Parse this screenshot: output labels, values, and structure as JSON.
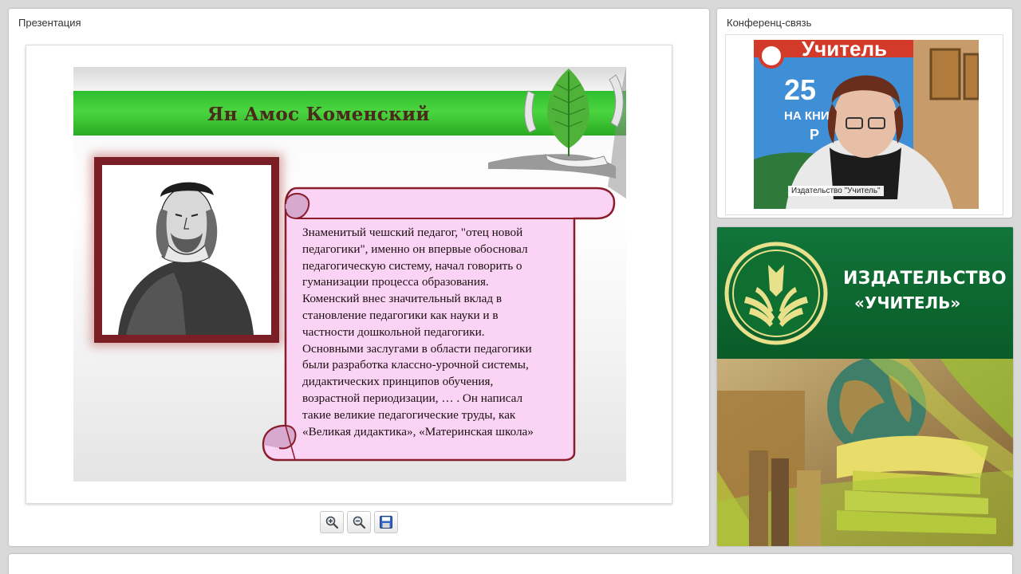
{
  "presentation": {
    "panel_title": "Презентация",
    "slide": {
      "title": "Ян Амос Коменский",
      "text_lines": [
        "Знаменитый чешский педагог, \"отец новой",
        "педагогики\", именно он впервые обосновал",
        "педагогическую систему, начал говорить о",
        "гуманизации процесса образования.",
        "Коменский внес значительный вклад в",
        "становление педагогики как науки и в",
        "частности дошкольной педагогики.",
        "Основными заслугами в области педагогики",
        "были разработка классно-урочной системы,",
        "дидактических принципов обучения,",
        "возрастной периодизации, … . Он написал",
        "такие великие педагогические труды, как",
        "«Великая дидактика», «Материнская школа»"
      ]
    },
    "toolbar": {
      "zoom_in_icon": "zoom-in-icon",
      "zoom_out_icon": "zoom-out-icon",
      "save_icon": "floppy-disk-icon"
    }
  },
  "conference": {
    "panel_title": "Конференц-связь",
    "video_caption": "Издательство \"Учитель\"",
    "poster": {
      "word": "Учитель",
      "number": "25",
      "line1": "НА КНИЖНОМ",
      "letter": "Р"
    }
  },
  "banner": {
    "name_line1": "ИЗДАТЕЛЬСТВО",
    "name_line2": "«УЧИТЕЛЬ»"
  },
  "colors": {
    "slide_green": "#3cc93a",
    "frame_maroon": "#7a1f25",
    "scroll_pink": "#fbd3f4",
    "banner_green": "#0d6b2d"
  }
}
